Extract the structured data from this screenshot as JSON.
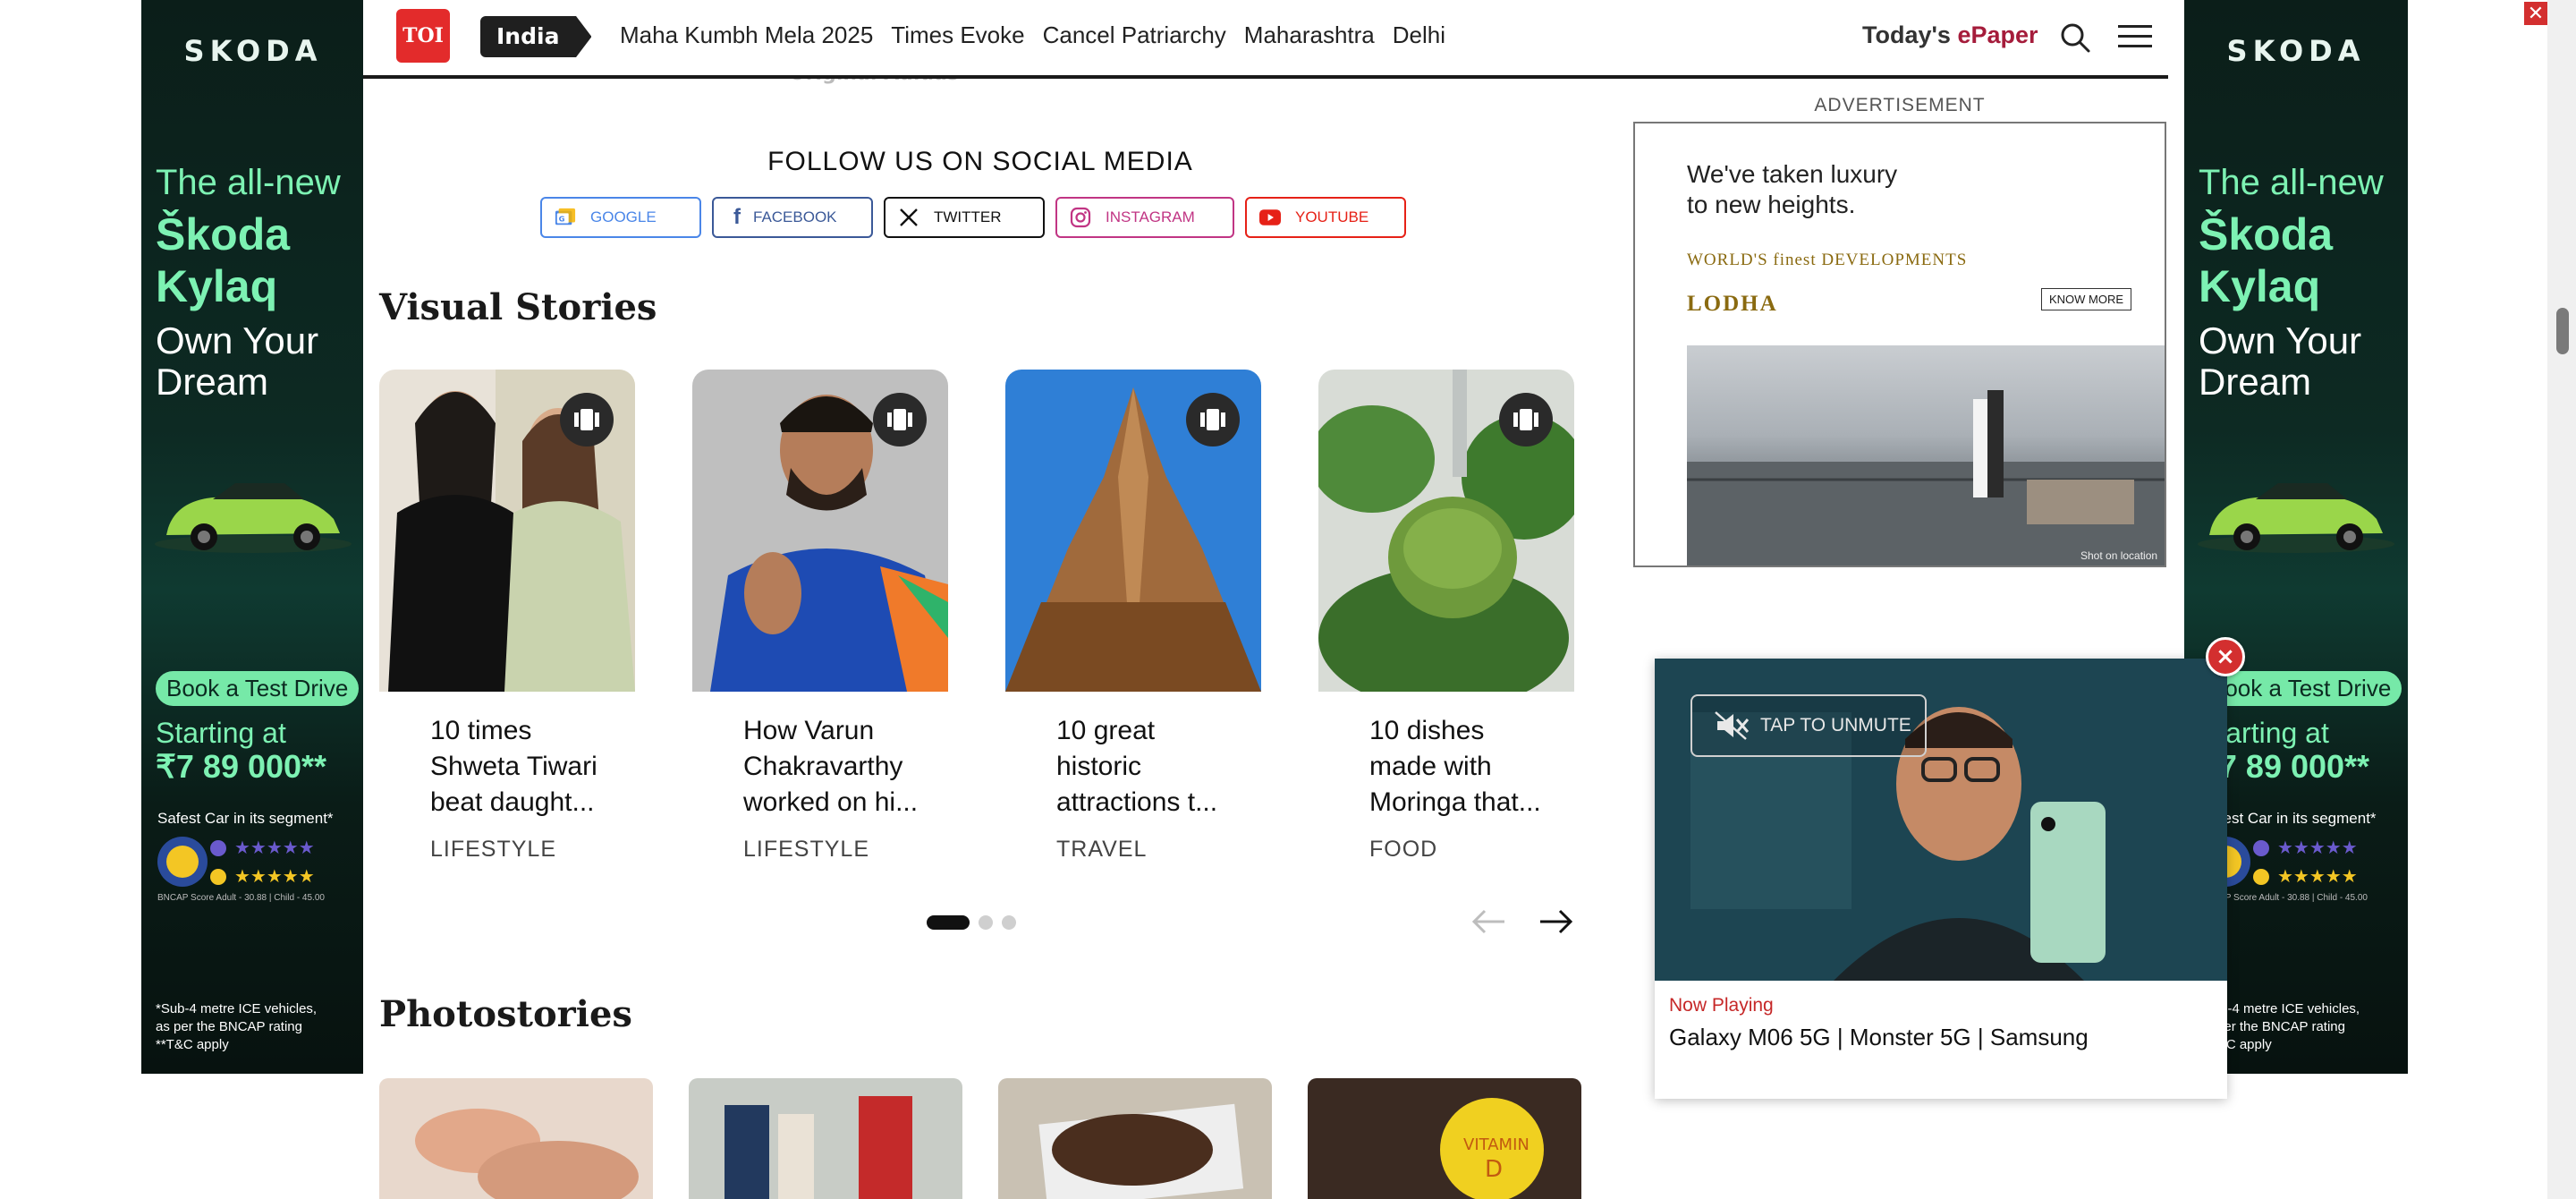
{
  "nav": {
    "logo": "TOI",
    "section": "India",
    "links": [
      "Maha Kumbh Mela 2025",
      "Times Evoke",
      "Cancel Patriarchy",
      "Maharashtra",
      "Delhi"
    ],
    "epaper_prefix": "Today's ",
    "epaper_suffix": "ePaper",
    "partial_text": "Original Adidas"
  },
  "social": {
    "heading": "FOLLOW US ON SOCIAL MEDIA",
    "buttons": [
      {
        "label": "GOOGLE",
        "color": "#4a86e8"
      },
      {
        "label": "FACEBOOK",
        "color": "#3b5998"
      },
      {
        "label": "TWITTER",
        "color": "#111111"
      },
      {
        "label": "INSTAGRAM",
        "color": "#c13584"
      },
      {
        "label": "YOUTUBE",
        "color": "#e62117"
      }
    ]
  },
  "visual_stories": {
    "heading": "Visual Stories",
    "items": [
      {
        "title_lines": [
          "10 times",
          "Shweta Tiwari",
          "beat daught..."
        ],
        "category": "LIFESTYLE"
      },
      {
        "title_lines": [
          "How Varun",
          "Chakravarthy",
          "worked on hi..."
        ],
        "category": "LIFESTYLE"
      },
      {
        "title_lines": [
          "10 great",
          "historic",
          "attractions t..."
        ],
        "category": "TRAVEL"
      },
      {
        "title_lines": [
          "10 dishes",
          "made with",
          "Moringa that..."
        ],
        "category": "FOOD"
      }
    ],
    "page_index": 1,
    "page_count": 3
  },
  "photostories": {
    "heading": "Photostories"
  },
  "sky_ad": {
    "brand": "SKODA",
    "line1": "The all-new",
    "line2a": "Škoda",
    "line2b": "Kylaq",
    "line3a": "Own Your",
    "line3b": "Dream",
    "cta": "Book a Test Drive",
    "start_label": "Starting at",
    "price": "₹7 89 000**",
    "safe": "Safest Car in its segment*",
    "score": "BNCAP Score Adult - 30.88 | Child - 45.00",
    "fine1": "*Sub-4 metre ICE vehicles,",
    "fine2": "as per the BNCAP rating",
    "fine3": "**T&C apply",
    "accent": "#7df2b3"
  },
  "right_ad": {
    "label": "ADVERTISEMENT",
    "line1": "We've taken luxury",
    "line2": "to new heights.",
    "tag": "WORLD'S finest DEVELOPMENTS",
    "brand": "LODHA",
    "cta": "KNOW MORE",
    "caption": "Shot on location"
  },
  "video": {
    "unmute": "TAP TO UNMUTE",
    "now_playing": "Now Playing",
    "title": "Galaxy M06 5G | Monster 5G | Samsung"
  }
}
